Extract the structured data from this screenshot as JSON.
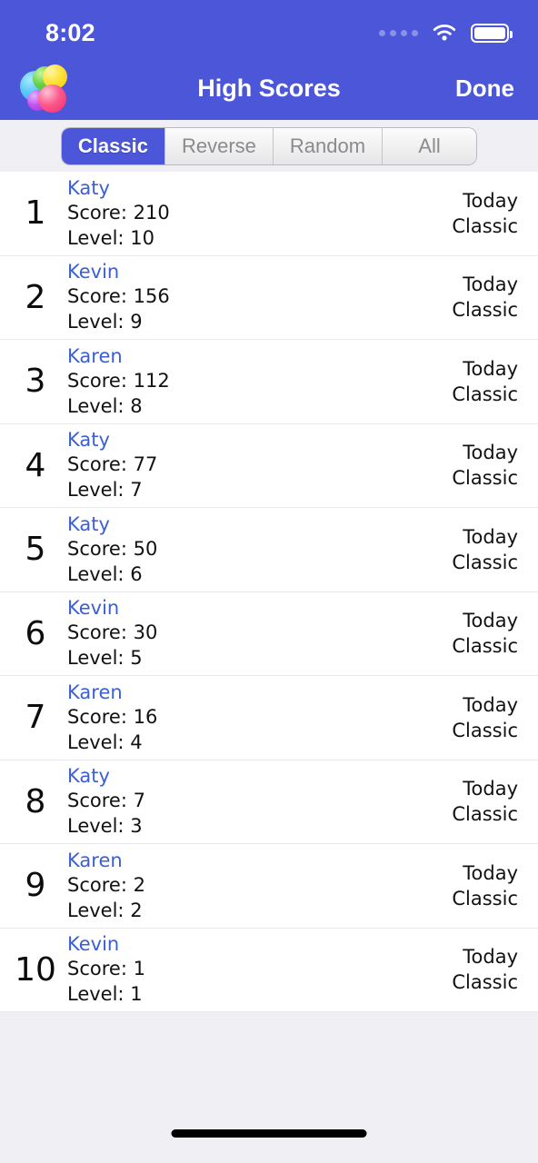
{
  "theme": {
    "header_blue": "#4b56d9",
    "name_blue": "#3a5fd9",
    "band_gray": "#efeff4",
    "divider": "#e8e8ec"
  },
  "status_bar": {
    "time": "8:02",
    "signal_icon": "signal-dots-icon",
    "wifi_icon": "wifi-icon",
    "battery_icon": "battery-icon"
  },
  "nav_bar": {
    "logo_icon": "bubbles-logo-icon",
    "title": "High Scores",
    "done_label": "Done"
  },
  "segmented_control": {
    "selected": "Classic",
    "options": [
      {
        "label": "Classic",
        "selected": true
      },
      {
        "label": "Reverse",
        "selected": false
      },
      {
        "label": "Random",
        "selected": false
      },
      {
        "label": "All",
        "selected": false
      }
    ]
  },
  "list": {
    "score_label": "Score:",
    "level_label": "Level:",
    "rows": [
      {
        "rank": "1",
        "name": "Katy",
        "score": "210",
        "level": "10",
        "date": "Today",
        "mode": "Classic"
      },
      {
        "rank": "2",
        "name": "Kevin",
        "score": "156",
        "level": "9",
        "date": "Today",
        "mode": "Classic"
      },
      {
        "rank": "3",
        "name": "Karen",
        "score": "112",
        "level": "8",
        "date": "Today",
        "mode": "Classic"
      },
      {
        "rank": "4",
        "name": "Katy",
        "score": "77",
        "level": "7",
        "date": "Today",
        "mode": "Classic"
      },
      {
        "rank": "5",
        "name": "Katy",
        "score": "50",
        "level": "6",
        "date": "Today",
        "mode": "Classic"
      },
      {
        "rank": "6",
        "name": "Kevin",
        "score": "30",
        "level": "5",
        "date": "Today",
        "mode": "Classic"
      },
      {
        "rank": "7",
        "name": "Karen",
        "score": "16",
        "level": "4",
        "date": "Today",
        "mode": "Classic"
      },
      {
        "rank": "8",
        "name": "Katy",
        "score": "7",
        "level": "3",
        "date": "Today",
        "mode": "Classic"
      },
      {
        "rank": "9",
        "name": "Karen",
        "score": "2",
        "level": "2",
        "date": "Today",
        "mode": "Classic"
      },
      {
        "rank": "10",
        "name": "Kevin",
        "score": "1",
        "level": "1",
        "date": "Today",
        "mode": "Classic"
      }
    ]
  },
  "footer": {
    "home_indicator_icon": "home-indicator"
  }
}
